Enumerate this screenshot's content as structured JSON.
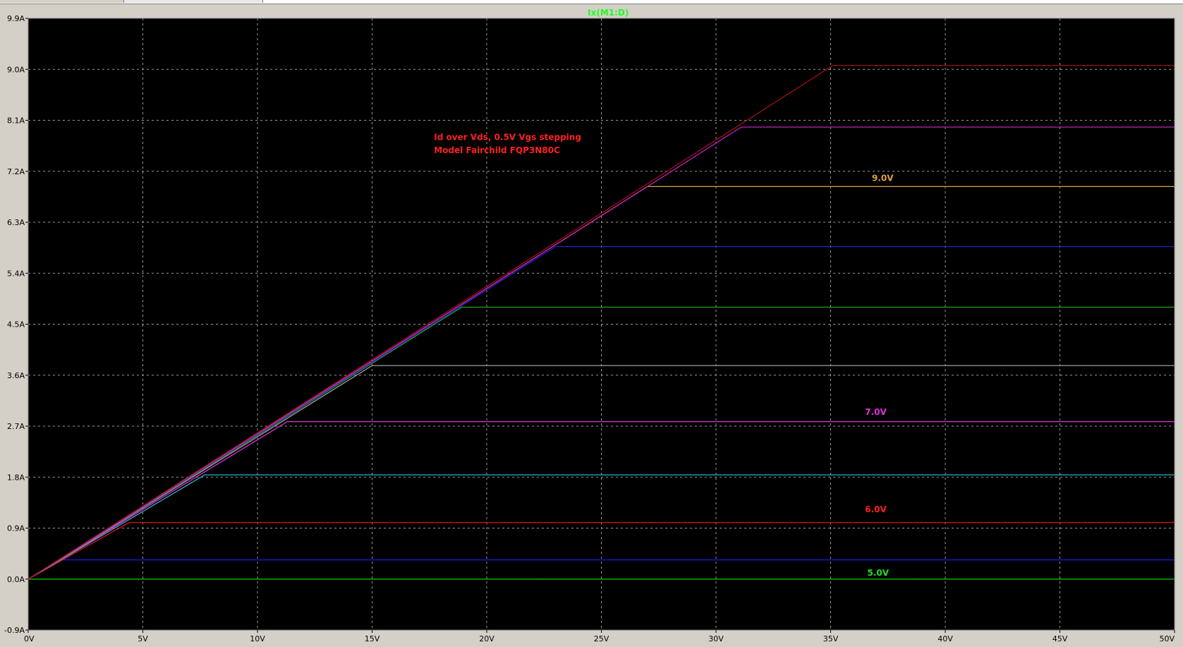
{
  "chart_data": {
    "type": "line",
    "title": "Ix(M1:D)",
    "xlabel": "",
    "ylabel": "",
    "xlim": [
      0,
      50
    ],
    "ylim": [
      -0.9,
      9.9
    ],
    "x_ticks": [
      {
        "value": 0,
        "label": "0V"
      },
      {
        "value": 5,
        "label": "5V"
      },
      {
        "value": 10,
        "label": "10V"
      },
      {
        "value": 15,
        "label": "15V"
      },
      {
        "value": 20,
        "label": "20V"
      },
      {
        "value": 25,
        "label": "25V"
      },
      {
        "value": 30,
        "label": "30V"
      },
      {
        "value": 35,
        "label": "35V"
      },
      {
        "value": 40,
        "label": "40V"
      },
      {
        "value": 45,
        "label": "45V"
      },
      {
        "value": 50,
        "label": "50V"
      }
    ],
    "y_ticks": [
      {
        "value": -0.9,
        "label": "-0.9A"
      },
      {
        "value": 0.0,
        "label": "0.0A"
      },
      {
        "value": 0.9,
        "label": "0.9A"
      },
      {
        "value": 1.8,
        "label": "1.8A"
      },
      {
        "value": 2.7,
        "label": "2.7A"
      },
      {
        "value": 3.6,
        "label": "3.6A"
      },
      {
        "value": 4.5,
        "label": "4.5A"
      },
      {
        "value": 5.4,
        "label": "5.4A"
      },
      {
        "value": 6.3,
        "label": "6.3A"
      },
      {
        "value": 7.2,
        "label": "7.2A"
      },
      {
        "value": 8.1,
        "label": "8.1A"
      },
      {
        "value": 9.0,
        "label": "9.0A"
      },
      {
        "value": 9.9,
        "label": "9.9A"
      }
    ],
    "grid": true,
    "background": "#000000",
    "series": [
      {
        "color": "#00c000",
        "points": [
          [
            0,
            0.0
          ],
          [
            50,
            0.0
          ]
        ]
      },
      {
        "color": "#1a1aff",
        "points": [
          [
            0,
            0.0
          ],
          [
            1.5,
            0.34
          ],
          [
            50,
            0.34
          ]
        ]
      },
      {
        "color": "#e01010",
        "points": [
          [
            0,
            0.0
          ],
          [
            4.4,
            1.0
          ],
          [
            50,
            1.0
          ]
        ]
      },
      {
        "color": "#30b0c8",
        "points": [
          [
            0,
            0.0
          ],
          [
            7.7,
            1.84
          ],
          [
            50,
            1.84
          ]
        ]
      },
      {
        "color": "#e030e0",
        "points": [
          [
            0,
            0.0
          ],
          [
            11.3,
            2.78
          ],
          [
            50,
            2.78
          ]
        ]
      },
      {
        "color": "#a0a0a0",
        "points": [
          [
            0,
            0.0
          ],
          [
            15.0,
            3.77
          ],
          [
            50,
            3.77
          ]
        ]
      },
      {
        "color": "#20a020",
        "points": [
          [
            0,
            0.0
          ],
          [
            18.9,
            4.8
          ],
          [
            50,
            4.8
          ]
        ]
      },
      {
        "color": "#2020d0",
        "points": [
          [
            0,
            0.0
          ],
          [
            23.0,
            5.87
          ],
          [
            50,
            5.87
          ]
        ]
      },
      {
        "color": "#e0a040",
        "points": [
          [
            0,
            0.0
          ],
          [
            27.0,
            6.93
          ],
          [
            50,
            6.93
          ]
        ]
      },
      {
        "color": "#c020c0",
        "points": [
          [
            0,
            0.0
          ],
          [
            31.1,
            7.98
          ],
          [
            50,
            7.98
          ]
        ]
      },
      {
        "color": "#a01010",
        "points": [
          [
            0,
            0.0
          ],
          [
            35.1,
            9.07
          ],
          [
            50,
            9.07
          ]
        ]
      }
    ],
    "annotations": [
      {
        "text": "Id over Vds, 0.5V Vgs stepping",
        "color": "#ff2020",
        "x": 17.7,
        "y": 7.75
      },
      {
        "text": "Model Fairchild FQP3N80C",
        "color": "#ff2020",
        "x": 17.7,
        "y": 7.52
      },
      {
        "text": "9.0V",
        "color": "#e0a040",
        "x": 36.8,
        "y": 7.03
      },
      {
        "text": "7.0V",
        "color": "#e030e0",
        "x": 36.5,
        "y": 2.9
      },
      {
        "text": "6.0V",
        "color": "#ff2020",
        "x": 36.5,
        "y": 1.18
      },
      {
        "text": "5.0V",
        "color": "#20e020",
        "x": 36.6,
        "y": 0.06
      }
    ]
  }
}
